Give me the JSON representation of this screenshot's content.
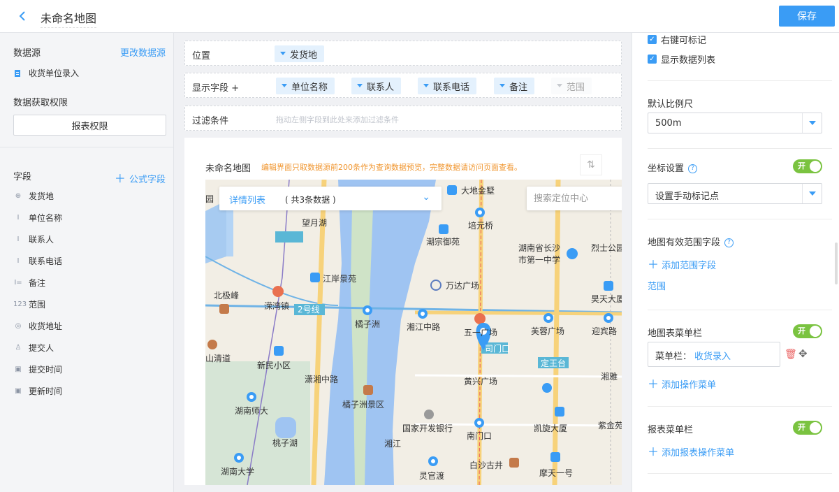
{
  "header": {
    "title": "未命名地图",
    "save_label": "保存"
  },
  "left": {
    "datasource_label": "数据源",
    "change_datasource": "更改数据源",
    "datasource_name": "收货单位录入",
    "permission_label": "数据获取权限",
    "permission_button": "报表权限",
    "fields_label": "字段",
    "formula_field": "公式字段",
    "fields": [
      {
        "icon": "⊕",
        "label": "发货地"
      },
      {
        "icon": "I",
        "label": "单位名称"
      },
      {
        "icon": "I",
        "label": "联系人"
      },
      {
        "icon": "I",
        "label": "联系电话"
      },
      {
        "icon": "I=",
        "label": "备注"
      },
      {
        "icon": "123",
        "label": "范围"
      },
      {
        "icon": "◎",
        "label": "收货地址"
      },
      {
        "icon": "♙",
        "label": "提交人"
      },
      {
        "icon": "▣",
        "label": "提交时间"
      },
      {
        "icon": "▣",
        "label": "更新时间"
      }
    ]
  },
  "center": {
    "position_label": "位置",
    "position_pill": "发货地",
    "display_label": "显示字段 +",
    "display_pills": [
      "单位名称",
      "联系人",
      "联系电话",
      "备注",
      "范围"
    ],
    "filter_label": "过滤条件",
    "filter_hint": "拖动左侧字段到此处来添加过滤条件",
    "preview_title": "未命名地图",
    "preview_warning": "编辑界面只取数据源前200条作为查询数据预览，完整数据请访问页面查看。",
    "detail_title": "详情列表",
    "detail_count": "( 共3条数据 )",
    "search_placeholder": "搜索定位中心",
    "map_labels": [
      "大地金墅",
      "培元桥",
      "潮宗御苑",
      "湖南省长沙",
      "市第一中学",
      "烈士公园",
      "万达广场",
      "昊天大厦",
      "望月湖",
      "江岸景苑",
      "北极峰",
      "溁湾镇",
      "2号线",
      "橘子洲",
      "湘江中路",
      "五一广场",
      "芙蓉广场",
      "迎宾路",
      "山清道",
      "新民小区",
      "黄兴广场",
      "湖南师大",
      "橘子洲景区",
      "国家开发银行",
      "凯旋大厦",
      "紫金苑",
      "南门口",
      "桃子湖",
      "湖南大学",
      "白沙古井",
      "灵官渡",
      "摩天一号",
      "湘江",
      "潇湘中路",
      "定王台",
      "湘雅",
      "园",
      "司门口"
    ]
  },
  "right": {
    "opt_right_click": "右键可标记",
    "opt_show_list": "显示数据列表",
    "scale_label": "默认比例尺",
    "scale_value": "500m",
    "coord_label": "坐标设置",
    "coord_toggle": "开",
    "coord_value": "设置手动标记点",
    "range_label": "地图有效范围字段",
    "add_range": "添加范围字段",
    "range_field": "范围",
    "menu_label": "地图表菜单栏",
    "menu_toggle": "开",
    "menu_item_label": "菜单栏：",
    "menu_item_value": "收货录入",
    "add_menu": "添加操作菜单",
    "report_menu_label": "报表菜单栏",
    "report_toggle": "开",
    "add_report_menu": "添加报表操作菜单"
  },
  "colors": {
    "accent": "#3a9cf5",
    "toggle_on": "#7ac340",
    "warning": "#f0952e",
    "river": "#9fc4f2",
    "road": "#f7d27a"
  }
}
